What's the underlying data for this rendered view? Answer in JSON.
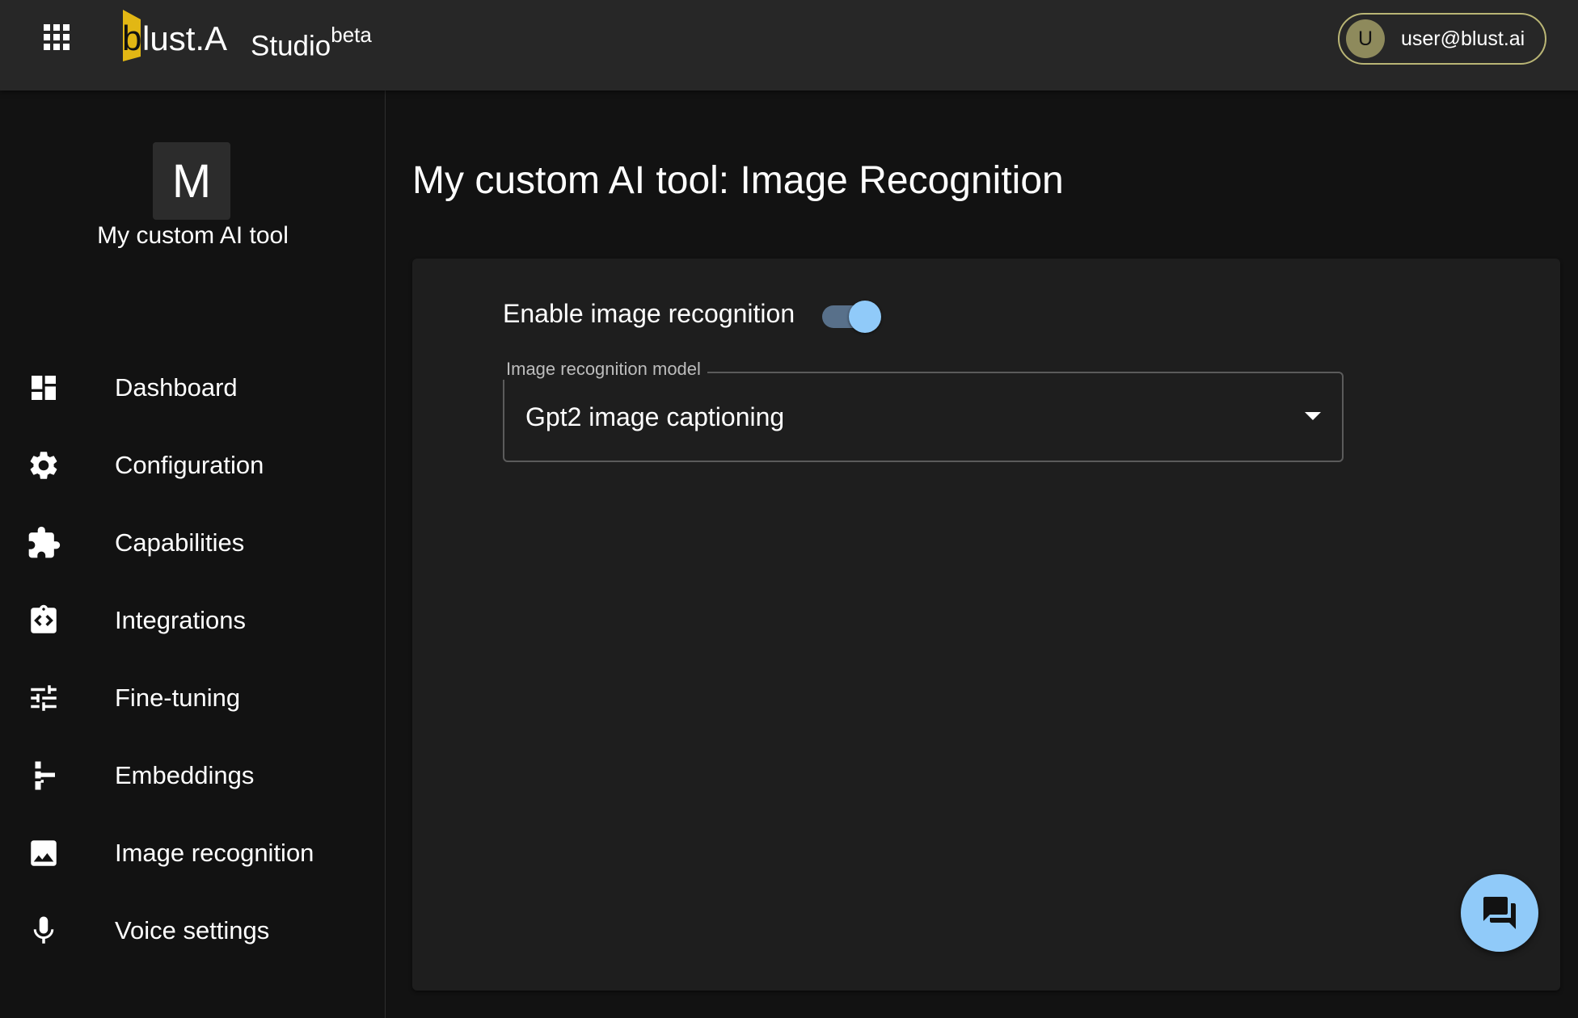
{
  "header": {
    "apps_icon": "apps-grid-icon",
    "logo_text_b": "b",
    "logo_text_rest": "lust.AI",
    "studio_label": "Studio",
    "studio_superscript": "beta",
    "user": {
      "initial": "U",
      "email": "user@blust.ai"
    },
    "colors": {
      "logo_accent": "#e2b714",
      "chip_border": "#b9b575",
      "avatar_bg": "#8e8a5c"
    }
  },
  "sidebar": {
    "tool_initial": "M",
    "tool_name": "My custom AI tool",
    "items": [
      {
        "label": "Dashboard",
        "icon": "dashboard-icon"
      },
      {
        "label": "Configuration",
        "icon": "gear-icon"
      },
      {
        "label": "Capabilities",
        "icon": "puzzle-icon"
      },
      {
        "label": "Integrations",
        "icon": "integration-icon"
      },
      {
        "label": "Fine-tuning",
        "icon": "tune-sliders-icon"
      },
      {
        "label": "Embeddings",
        "icon": "account-tree-icon"
      },
      {
        "label": "Image recognition",
        "icon": "image-icon"
      },
      {
        "label": "Voice settings",
        "icon": "microphone-icon"
      }
    ]
  },
  "main": {
    "title": "My custom AI tool: Image Recognition",
    "toggle": {
      "label": "Enable image recognition",
      "enabled": true
    },
    "model_select": {
      "label": "Image recognition model",
      "value": "Gpt2 image captioning"
    },
    "fab_icon": "chat-icon"
  },
  "colors": {
    "accent": "#90caf9",
    "background": "#121212",
    "card": "#1e1e1e",
    "topbar": "#272727"
  }
}
